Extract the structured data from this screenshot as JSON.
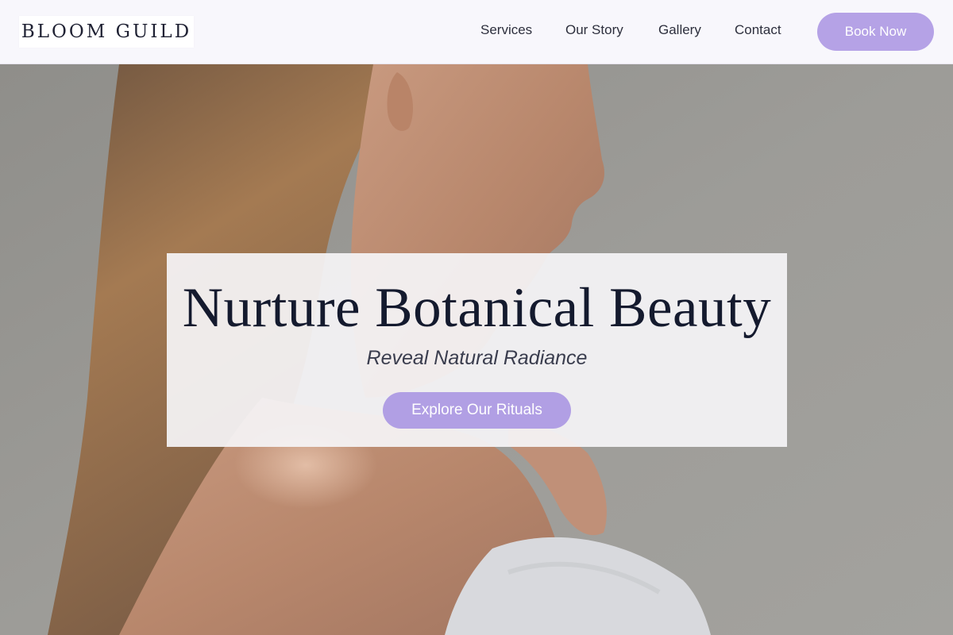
{
  "brand": {
    "name": "BLOOM GUILD"
  },
  "nav": {
    "items": [
      {
        "label": "Services"
      },
      {
        "label": "Our Story"
      },
      {
        "label": "Gallery"
      },
      {
        "label": "Contact"
      }
    ],
    "cta_label": "Book Now"
  },
  "hero": {
    "title": "Nurture Botanical Beauty",
    "subtitle": "Reveal Natural Radiance",
    "cta_label": "Explore Our Rituals"
  },
  "colors": {
    "accent": "#b5a2e6",
    "header_bg": "#f8f7fc",
    "title_text": "#141a2e"
  }
}
